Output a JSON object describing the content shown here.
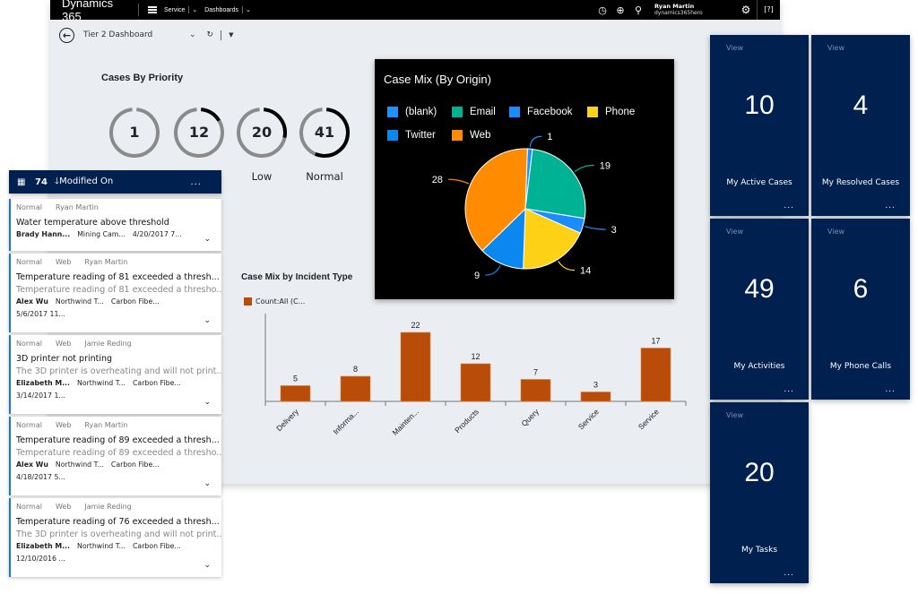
{
  "topbar": {
    "brand": "Dynamics 365",
    "nav": [
      {
        "label": "Service"
      },
      {
        "label": "Dashboards"
      }
    ],
    "icons": [
      "clock-icon",
      "add-icon",
      "search-icon"
    ],
    "user_name": "Ryan Martin",
    "user_org": "dynamics365hero",
    "settings_icon": "gear-icon",
    "help_icon": "help-icon"
  },
  "subbar": {
    "title": "Tier 2 Dashboard",
    "dropdown_glyph": "⌄",
    "refresh_glyph": "↻",
    "filter_glyph": "▼"
  },
  "priority": {
    "title": "Cases By Priority",
    "rings": [
      {
        "value": "1",
        "label": "",
        "fraction": 0.0
      },
      {
        "value": "12",
        "label": "",
        "fraction": 0.15
      },
      {
        "value": "20",
        "label": "Low",
        "fraction": 0.27
      },
      {
        "value": "41",
        "label": "Normal",
        "fraction": 0.55
      }
    ]
  },
  "chart_data": [
    {
      "type": "pie",
      "title": "Case Mix (By Origin)",
      "legend": [
        {
          "name": "(blank)",
          "color": "#1e90ff"
        },
        {
          "name": "Email",
          "color": "#00b294"
        },
        {
          "name": "Facebook",
          "color": "#1a8cff"
        },
        {
          "name": "Phone",
          "color": "#fcd116"
        },
        {
          "name": "Twitter",
          "color": "#0a88f0"
        },
        {
          "name": "Web",
          "color": "#ff8c00"
        }
      ],
      "slices": [
        {
          "name": "(blank)",
          "value": 1,
          "color": "#1e90ff"
        },
        {
          "name": "Email",
          "value": 19,
          "color": "#00b294"
        },
        {
          "name": "Facebook",
          "value": 3,
          "color": "#1a8cff"
        },
        {
          "name": "Phone",
          "value": 14,
          "color": "#fcd116"
        },
        {
          "name": "Twitter",
          "value": 9,
          "color": "#0a88f0"
        },
        {
          "name": "Web",
          "value": 28,
          "color": "#ff8c00"
        }
      ]
    },
    {
      "type": "bar",
      "title": "Case Mix by Incident Type",
      "legend": "Count:All (C...",
      "color": "#b84c08",
      "categories": [
        "Delivery",
        "Informa...",
        "Mainten...",
        "Products",
        "Query",
        "Service",
        "Service"
      ],
      "values": [
        5,
        8,
        22,
        12,
        7,
        3,
        17
      ],
      "ylim": [
        0,
        24
      ]
    }
  ],
  "case_list": {
    "count": "74",
    "sort_label": "Modified On",
    "more": "...",
    "items": [
      {
        "priority": "Normal",
        "origin": "",
        "owner": "Ryan Martin",
        "title": "Water temperature above threshold",
        "desc": "",
        "customer": "Brady Hann...",
        "account": "Mining Cam...",
        "product": "",
        "date": "4/20/2017 7...",
        "inline_date": true
      },
      {
        "priority": "Normal",
        "origin": "Web",
        "owner": "Ryan Martin",
        "title": "Temperature reading of 81 exceeded a thresh...",
        "desc": "Temperature reading of 81 exceeded a thresho...",
        "customer": "Alex Wu",
        "account": "Northwind T...",
        "product": "Carbon Fibe...",
        "date": "5/6/2017 11...",
        "inline_date": false
      },
      {
        "priority": "Normal",
        "origin": "Web",
        "owner": "Jamie Reding",
        "title": "3D printer not printing",
        "desc": "The 3D printer is overheating and will not print...",
        "customer": "Elizabeth M...",
        "account": "Northwind T...",
        "product": "Carbon Fibe...",
        "date": "3/14/2017 1...",
        "inline_date": false
      },
      {
        "priority": "Normal",
        "origin": "Web",
        "owner": "Ryan Martin",
        "title": "Temperature reading of 89 exceeded a thresh...",
        "desc": "Temperature reading of 89 exceeded a thresho...",
        "customer": "Alex Wu",
        "account": "Northwind T...",
        "product": "Carbon Fibe...",
        "date": "4/18/2017 5...",
        "inline_date": false
      },
      {
        "priority": "Normal",
        "origin": "Web",
        "owner": "Jamie Reding",
        "title": "Temperature reading of 76 exceeded a thresh...",
        "desc": "The 3D printer is overheating and will not print...",
        "customer": "Elizabeth M...",
        "account": "Northwind T...",
        "product": "Carbon Fibe...",
        "date": "12/10/2016 ...",
        "inline_date": false
      }
    ]
  },
  "tiles": [
    {
      "view": "View",
      "value": "10",
      "label": "My Active Cases",
      "more": "..."
    },
    {
      "view": "View",
      "value": "4",
      "label": "My Resolved Cases",
      "more": "..."
    },
    {
      "view": "View",
      "value": "49",
      "label": "My Activities",
      "more": "..."
    },
    {
      "view": "View",
      "value": "6",
      "label": "My Phone Calls",
      "more": "..."
    },
    {
      "view": "View",
      "value": "20",
      "label": "My Tasks",
      "more": "..."
    }
  ]
}
